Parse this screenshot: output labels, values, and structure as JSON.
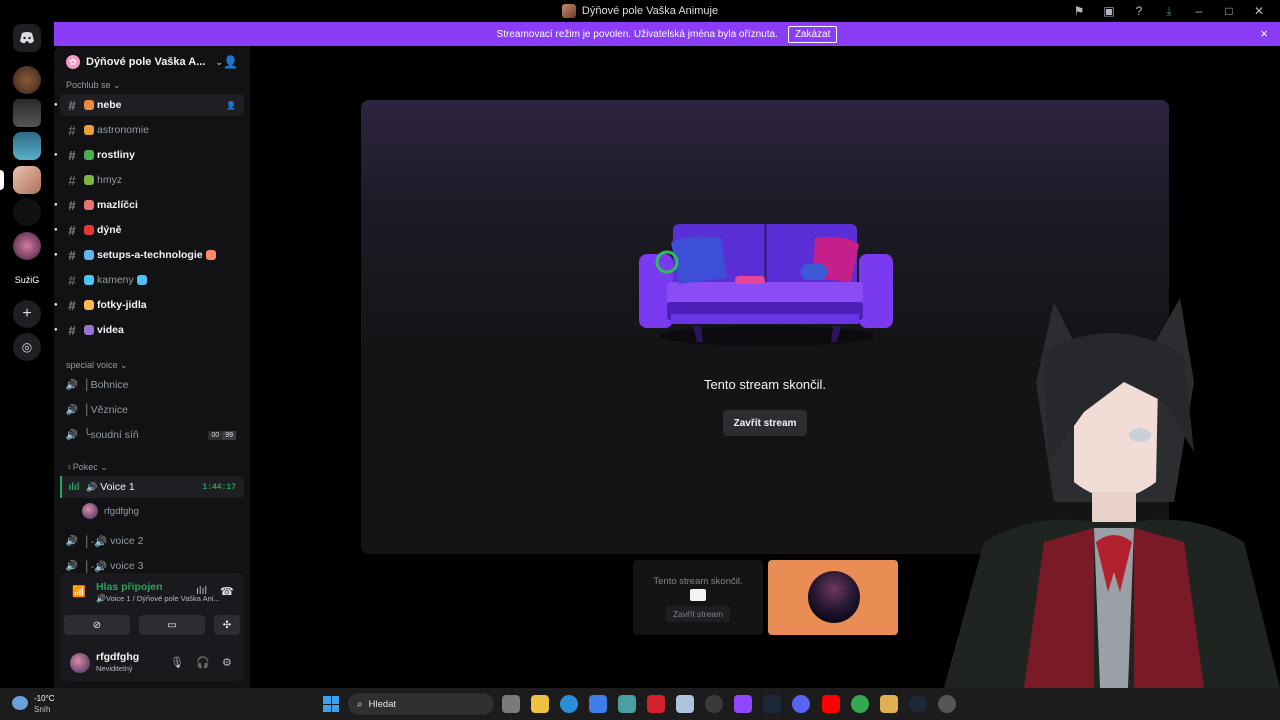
{
  "window": {
    "title": "Dýňové pole Vaška Animuje"
  },
  "rail": {
    "folder_label": "SužiG"
  },
  "banner": {
    "text": "Streamovací režim je povolen. Uživatelská jména byla oříznuta.",
    "button": "Zakázat",
    "close_icon": "×"
  },
  "server": {
    "name": "Dýňové pole Vaška A...",
    "category_1": "Pochlub se",
    "channels": [
      {
        "name": "nebe",
        "unread": true
      },
      {
        "name": "astronomie",
        "unread": false
      },
      {
        "name": "rostliny",
        "unread": true
      },
      {
        "name": "hmyz",
        "unread": false
      },
      {
        "name": "mazlíčci",
        "unread": true
      },
      {
        "name": "dýně",
        "unread": true
      },
      {
        "name": "setups-a-technologie",
        "unread": true
      },
      {
        "name": "kameny",
        "unread": false
      },
      {
        "name": "fotky-jidla",
        "unread": true
      },
      {
        "name": "videa",
        "unread": true
      }
    ],
    "category_2": "special voice",
    "special_voice": [
      {
        "name": "│Bohnice"
      },
      {
        "name": "│Věznice"
      },
      {
        "name": "╰soudní síň",
        "badge_left": "00",
        "badge_right": "99"
      }
    ],
    "category_3": "♀Pokec",
    "voice_channels": [
      {
        "name": "Voice 1",
        "time": "1:44:17"
      },
      {
        "name": "voice 2"
      },
      {
        "name": "voice 3"
      }
    ],
    "voice_member": "rfgdfghg"
  },
  "voice_panel": {
    "status": "Hlas připojen",
    "sub": "Voice 1 / Dýňové pole Vaška Ani..."
  },
  "user": {
    "name": "rfgdfghg",
    "status": "Neviditelný"
  },
  "stage": {
    "ended_text": "Tento stream skončil.",
    "close_button": "Zavřít stream"
  },
  "thumb": {
    "text": "Tento stream skončil.",
    "button": "Zavřít stream"
  },
  "taskbar": {
    "weather_temp": "-10°C",
    "weather_cond": "Sníh",
    "search_placeholder": "Hledat"
  },
  "colors": {
    "banner": "#8b3cf6",
    "connected": "#23a55a",
    "thumb_bg": "#e98d55"
  }
}
